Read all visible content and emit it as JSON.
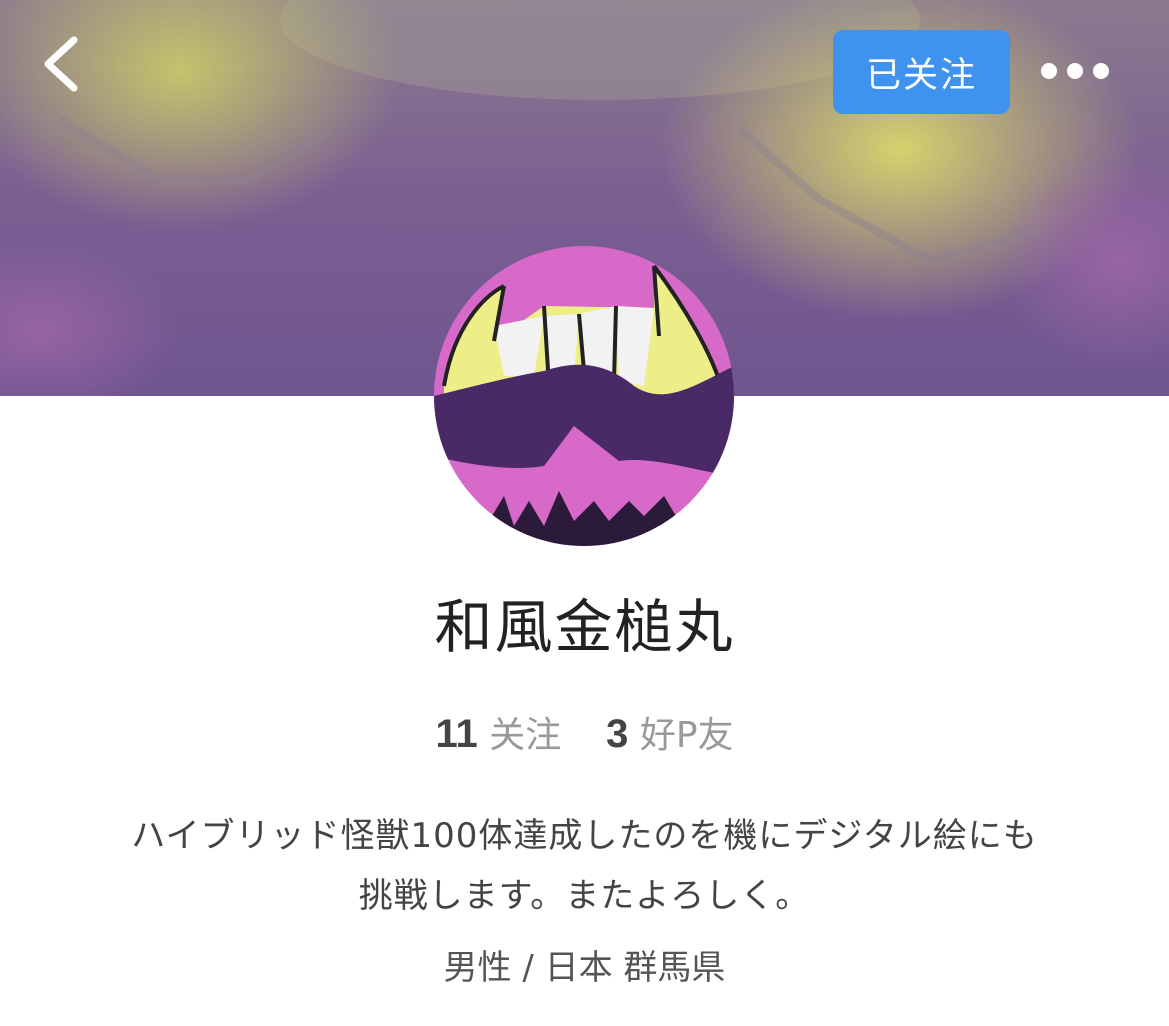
{
  "header": {
    "follow_label": "已关注",
    "back_icon": "chevron-left-icon",
    "more_icon": "more-horizontal-icon"
  },
  "profile": {
    "name": "和風金槌丸",
    "following_count": "11",
    "following_label": "关注",
    "friends_count": "3",
    "friends_label": "好P友",
    "bio_line1": "ハイブリッド怪獣100体達成したのを機にデジタル絵にも",
    "bio_line2": "挑戦します。またよろしく。",
    "location": "男性 / 日本 群馬県"
  },
  "colors": {
    "accent": "#3f93ef",
    "cover_purple": "#7a5a8e",
    "avatar_pink": "#d76ac8",
    "avatar_purple": "#4a2a66",
    "avatar_yellow": "#eeee88"
  }
}
